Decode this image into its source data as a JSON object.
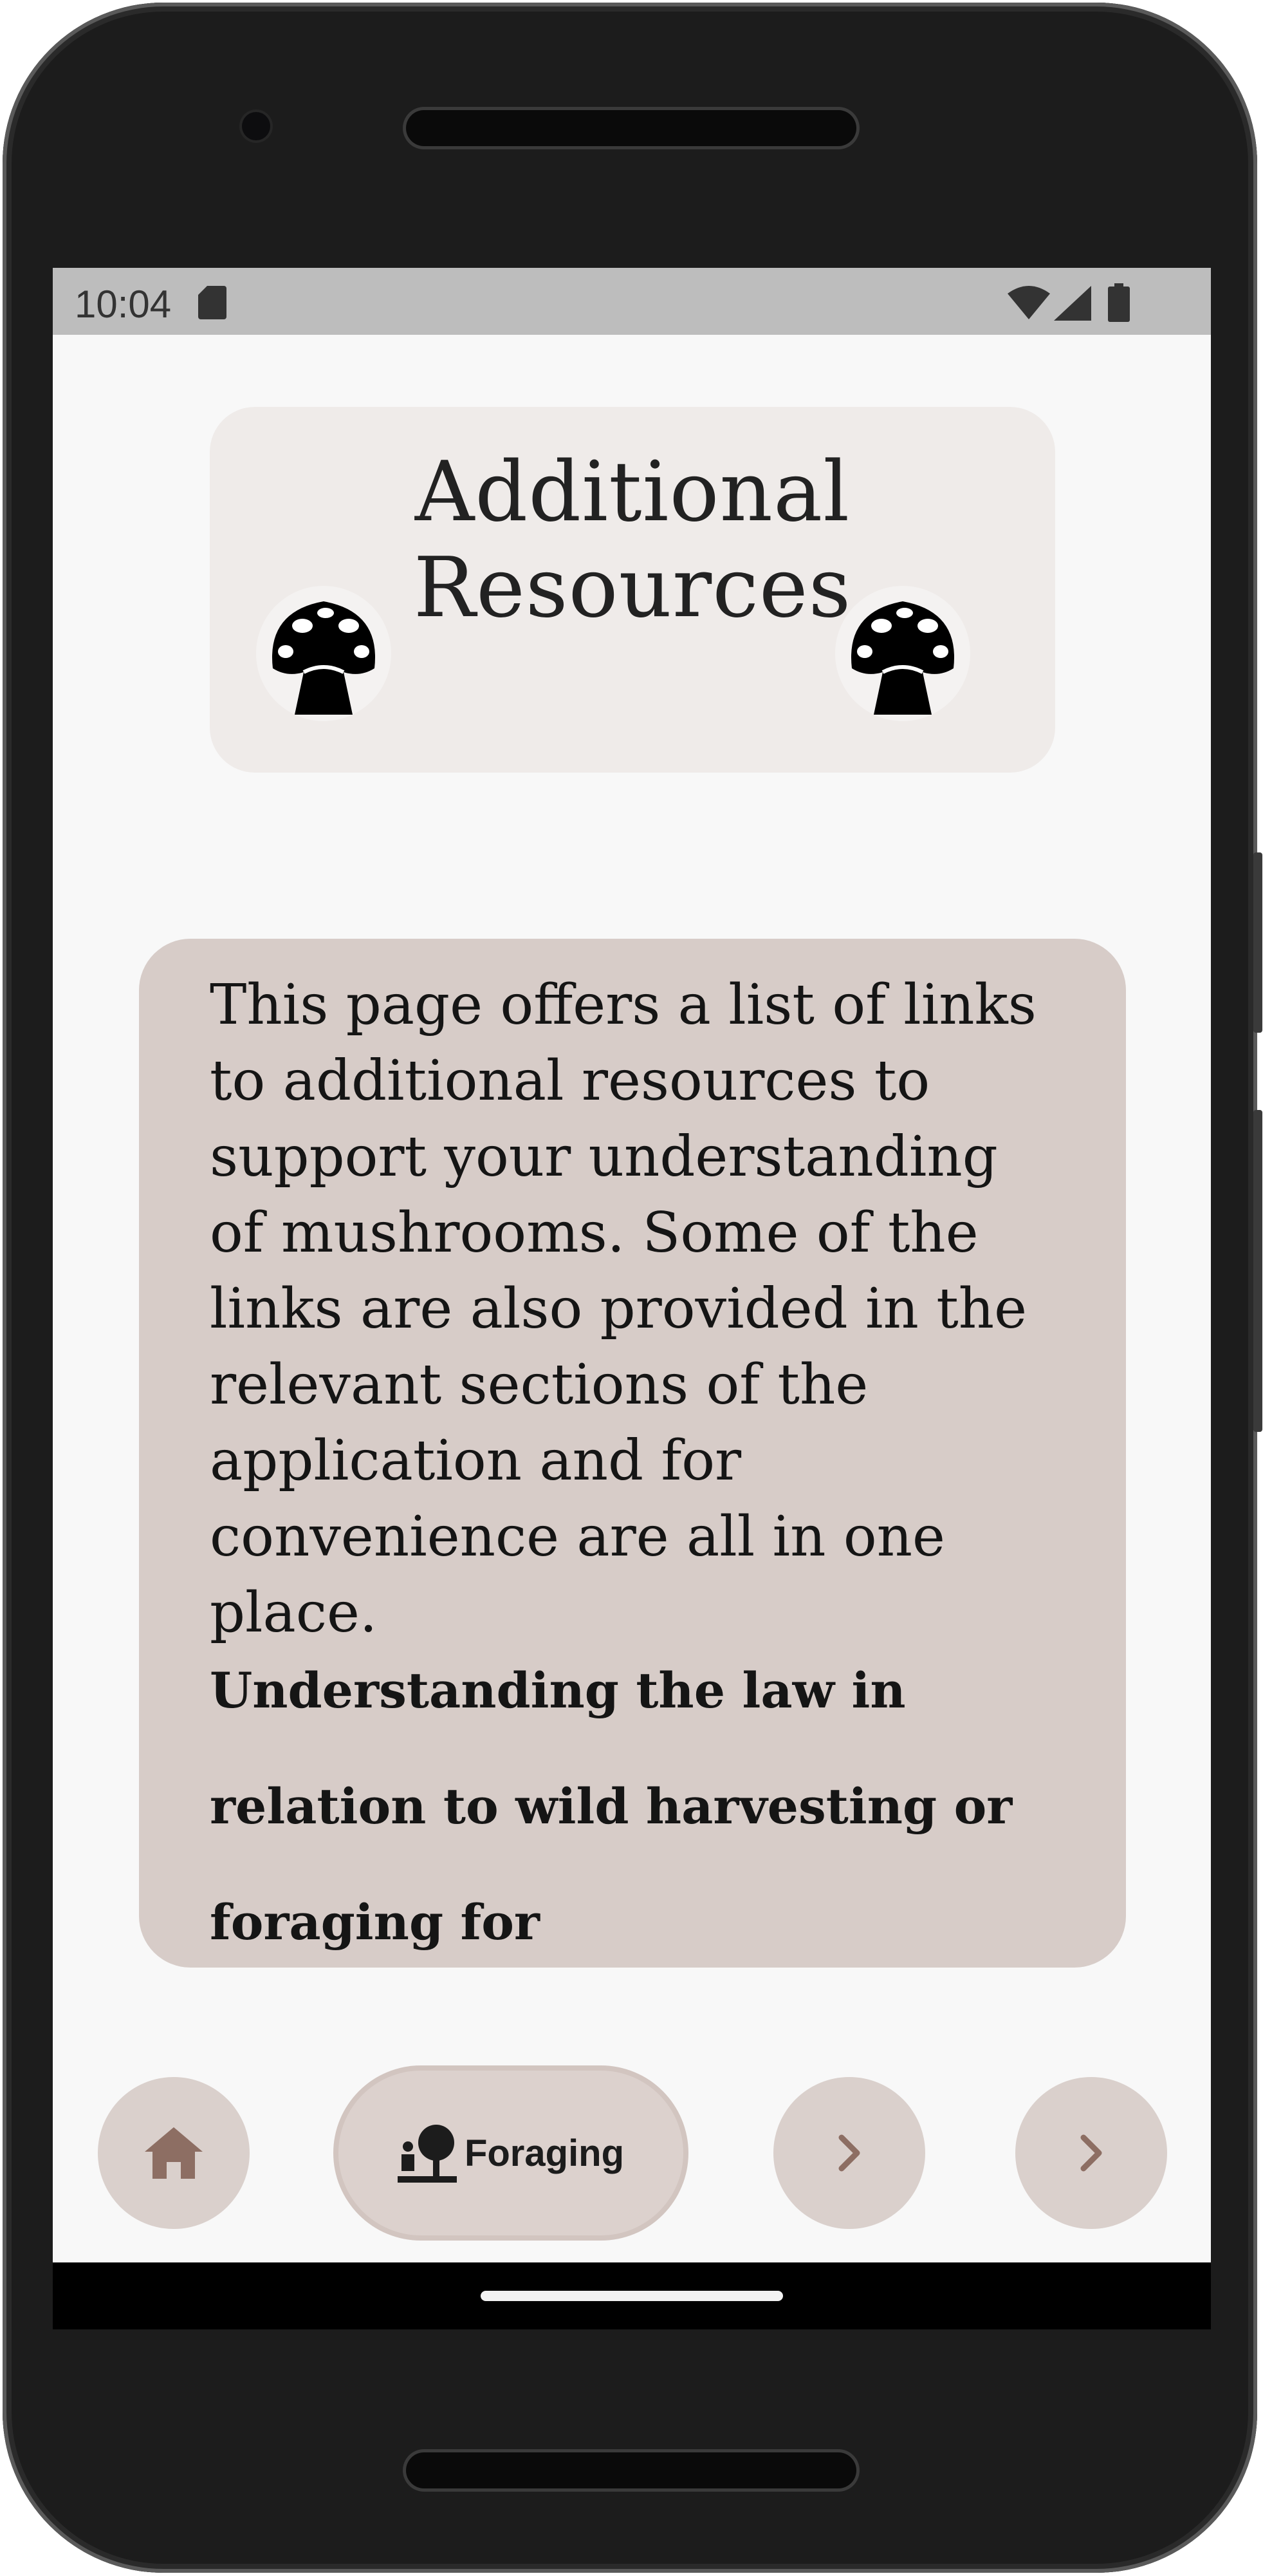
{
  "status_bar": {
    "time": "10:04",
    "icons": [
      "sd-card-icon",
      "wifi-icon",
      "signal-icon",
      "battery-icon"
    ]
  },
  "header": {
    "title": "Additional Resources",
    "icons": [
      "mushroom-icon",
      "mushroom-icon"
    ]
  },
  "info_card": {
    "paragraph": "This page offers a list of links to additional resources to support your understanding of mushrooms.  Some of the links are also provided in the relevant sections of the application and for convenience are all in one place.",
    "heading_partial": "Understanding the law in relation to wild harvesting or foraging for"
  },
  "bottom_nav": {
    "home_icon": "home-icon",
    "active_label": "Foraging",
    "active_icon": "foraging-icon",
    "next_icons": [
      "chevron-right-icon",
      "chevron-right-icon"
    ]
  },
  "colors": {
    "screen_bg": "#f8f8f8",
    "header_card_bg": "#efebe9",
    "info_card_bg": "#d7ccc8",
    "nav_button_bg": "#dad0cc",
    "nav_icon": "#8d6e63"
  }
}
